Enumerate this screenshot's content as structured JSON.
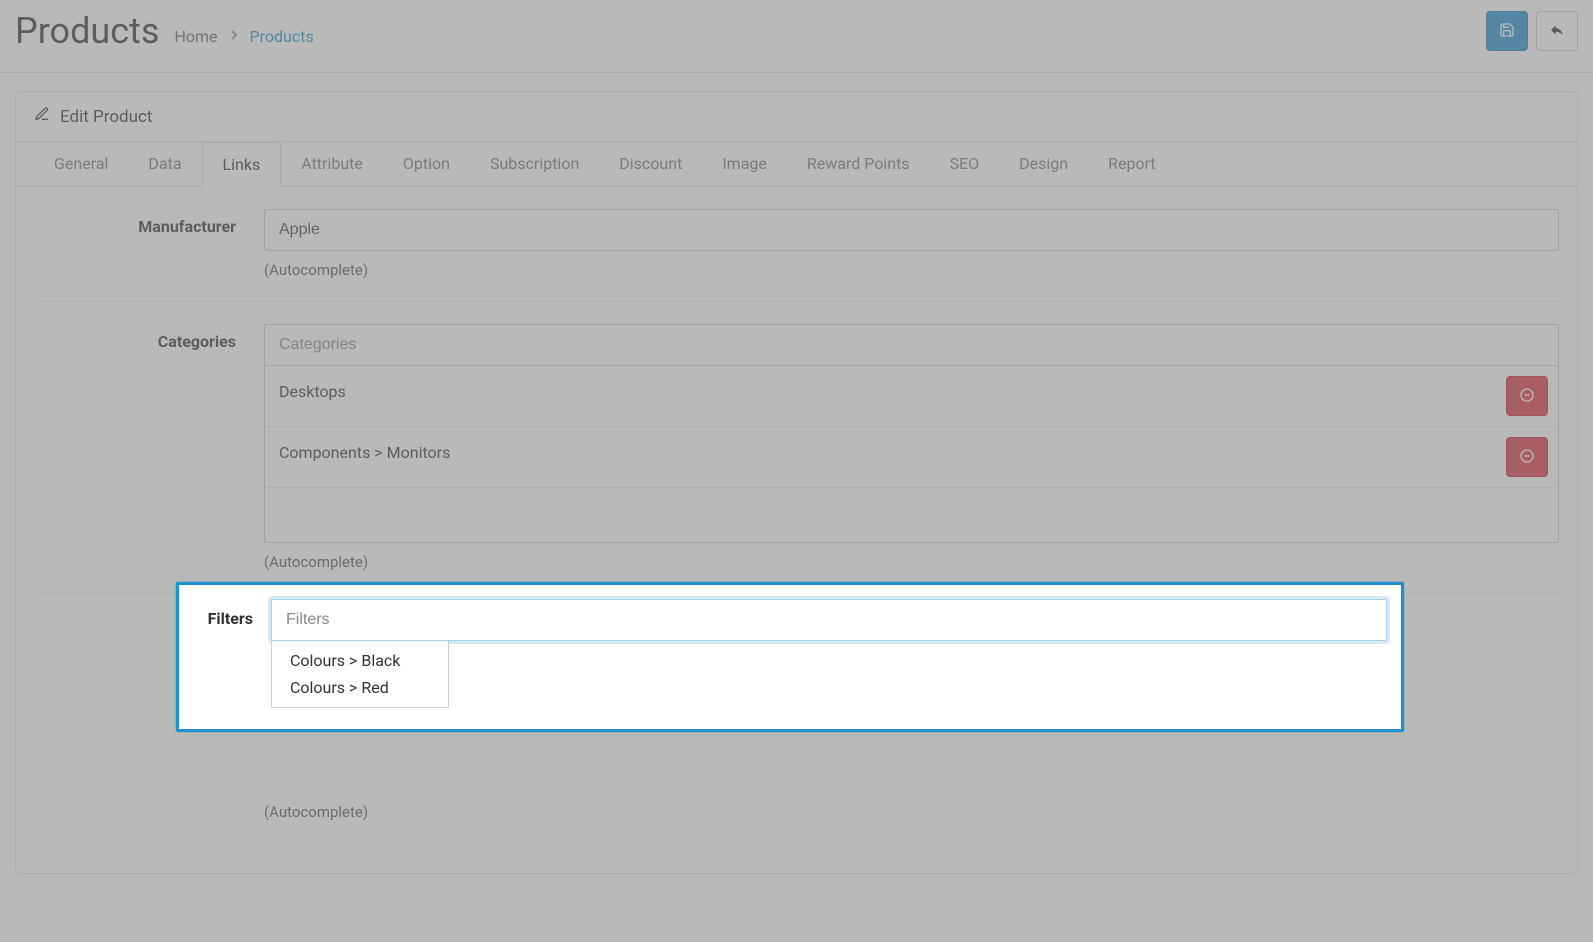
{
  "header": {
    "title": "Products",
    "breadcrumb_home": "Home",
    "breadcrumb_current": "Products"
  },
  "panel": {
    "heading": "Edit Product"
  },
  "tabs": [
    {
      "label": "General"
    },
    {
      "label": "Data"
    },
    {
      "label": "Links"
    },
    {
      "label": "Attribute"
    },
    {
      "label": "Option"
    },
    {
      "label": "Subscription"
    },
    {
      "label": "Discount"
    },
    {
      "label": "Image"
    },
    {
      "label": "Reward Points"
    },
    {
      "label": "SEO"
    },
    {
      "label": "Design"
    },
    {
      "label": "Report"
    }
  ],
  "active_tab_index": 2,
  "manufacturer": {
    "label": "Manufacturer",
    "value": "Apple",
    "help": "(Autocomplete)"
  },
  "categories": {
    "label": "Categories",
    "placeholder": "Categories",
    "items": [
      {
        "label": "Desktops"
      },
      {
        "label": "Components > Monitors"
      }
    ],
    "help": "(Autocomplete)"
  },
  "filters": {
    "label": "Filters",
    "placeholder": "Filters",
    "options": [
      {
        "label": "Colours > Black"
      },
      {
        "label": "Colours > Red"
      }
    ],
    "help": "(Autocomplete)"
  },
  "colors": {
    "accent": "#1e91cf",
    "danger": "#dc3545"
  }
}
